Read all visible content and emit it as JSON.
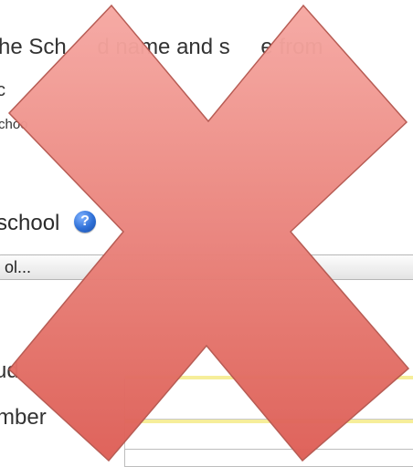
{
  "intro_text": "he Sch       d name and s       e from",
  "fragment_a": "c",
  "fragment_b": "choo",
  "school_label": "school",
  "help_icon_glyph": "?",
  "school_select_value": "ol...",
  "label_student": "ud",
  "label_number": "mber",
  "overlay": {
    "icon": "red-x-icon",
    "fill_color": "#e8746a",
    "stroke_color": "#9b3a34"
  }
}
